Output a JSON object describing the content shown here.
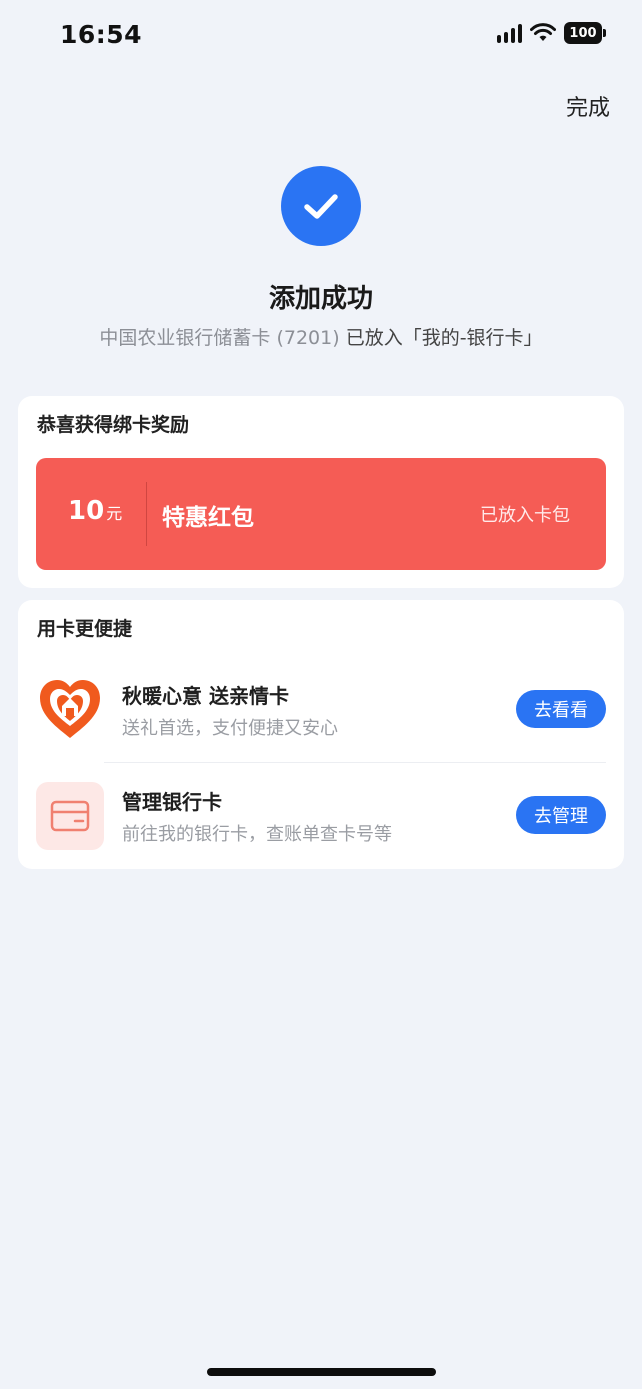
{
  "status_bar": {
    "time": "16:54",
    "battery": "100",
    "icons": [
      "signal-icon",
      "wifi-icon",
      "battery-icon"
    ]
  },
  "header": {
    "done_label": "完成"
  },
  "result": {
    "icon": "check-icon",
    "title": "添加成功",
    "card_desc": "中国农业银行储蓄卡 (7201)",
    "placed_text": "已放入「我的-银行卡」"
  },
  "reward": {
    "section_title": "恭喜获得绑卡奖励",
    "amount": "10",
    "unit": "元",
    "name": "特惠红包",
    "status": "已放入卡包"
  },
  "convenience": {
    "section_title": "用卡更便捷",
    "items": [
      {
        "icon": "heart-gift-icon",
        "name": "秋暖心意 送亲情卡",
        "desc": "送礼首选，支付便捷又安心",
        "button": "去看看"
      },
      {
        "icon": "bank-card-icon",
        "name": "管理银行卡",
        "desc": "前往我的银行卡，查账单查卡号等",
        "button": "去管理"
      }
    ]
  },
  "colors": {
    "accent_blue": "#2a74f3",
    "red_packet": "#f55c55",
    "background": "#f0f3f9",
    "heart_orange": "#f05a1e"
  }
}
